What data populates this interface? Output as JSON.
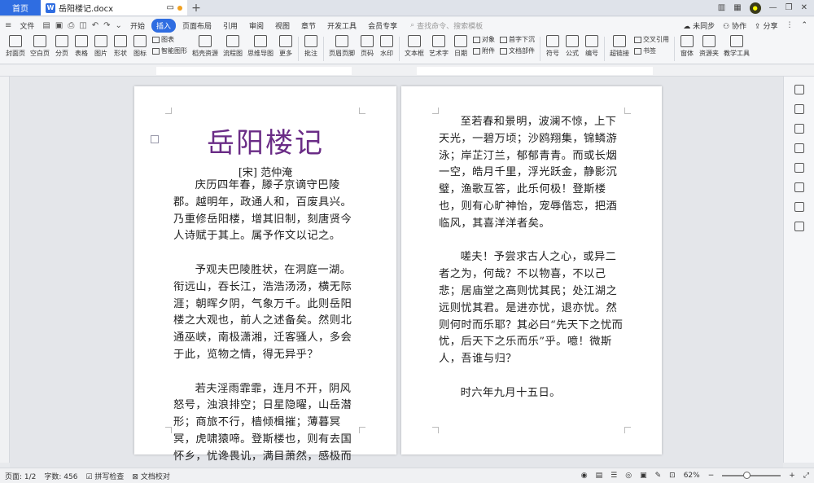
{
  "tabs": {
    "home": "首页",
    "doc": "岳阳楼记.docx"
  },
  "menu": {
    "file": "文件",
    "items": [
      "开始",
      "插入",
      "页面布局",
      "引用",
      "审阅",
      "视图",
      "章节",
      "开发工具",
      "会员专享"
    ],
    "active_index": 1,
    "search_placeholder": "查找命令、搜索模板",
    "sync": "未同步",
    "collab": "协作",
    "share": "分享"
  },
  "ribbon": {
    "buttons": [
      "封面页",
      "空白页",
      "分页",
      "表格",
      "图片",
      "形状",
      "图标",
      "稻壳资源",
      "流程图",
      "思维导图",
      "更多",
      "批注",
      "页眉页脚",
      "页码",
      "水印",
      "文本框",
      "艺术字",
      "日期",
      "附件",
      "文档部件",
      "符号",
      "公式",
      "编号",
      "超链接",
      "书签",
      "窗体",
      "资源夹",
      "教学工具"
    ],
    "col_chart": "图表",
    "col_smart": "智能图形",
    "col_object": "对象",
    "col_dropcap": "首字下沉",
    "col_crossref": "交叉引用"
  },
  "document": {
    "title": "岳阳楼记",
    "author": "[宋] 范仲淹",
    "page1_paragraphs": [
      "庆历四年春，滕子京谪守巴陵郡。越明年，政通人和，百废具兴。乃重修岳阳楼，增其旧制，刻唐贤今人诗赋于其上。属予作文以记之。",
      "予观夫巴陵胜状，在洞庭一湖。衔远山，吞长江，浩浩汤汤，横无际涯；朝晖夕阴，气象万千。此则岳阳楼之大观也，前人之述备矣。然则北通巫峡，南极潇湘，迁客骚人，多会于此，览物之情，得无异乎？",
      "若夫淫雨霏霏，连月不开，阴风怒号，浊浪排空；日星隐曜，山岳潜形；商旅不行，樯倾楫摧；薄暮冥冥，虎啸猿啼。登斯楼也，则有去国怀乡，忧谗畏讥，满目萧然，感极而悲者矣。"
    ],
    "page2_paragraphs": [
      "至若春和景明，波澜不惊，上下天光，一碧万顷；沙鸥翔集，锦鳞游泳；岸芷汀兰，郁郁青青。而或长烟一空，皓月千里，浮光跃金，静影沉璧，渔歌互答，此乐何极！登斯楼也，则有心旷神怡，宠辱偕忘，把酒临风，其喜洋洋者矣。",
      "嗟夫！予尝求古人之心，或异二者之为，何哉？不以物喜，不以己悲；居庙堂之高则忧其民；处江湖之远则忧其君。是进亦忧，退亦忧。然则何时而乐耶？其必曰“先天下之忧而忧，后天下之乐而乐”乎。噫！微斯人，吾谁与归？",
      "时六年九月十五日。"
    ]
  },
  "status": {
    "page": "页面: 1/2",
    "words": "字数: 456",
    "spell": "拼写检查",
    "proof": "文档校对",
    "zoom": "62%"
  }
}
